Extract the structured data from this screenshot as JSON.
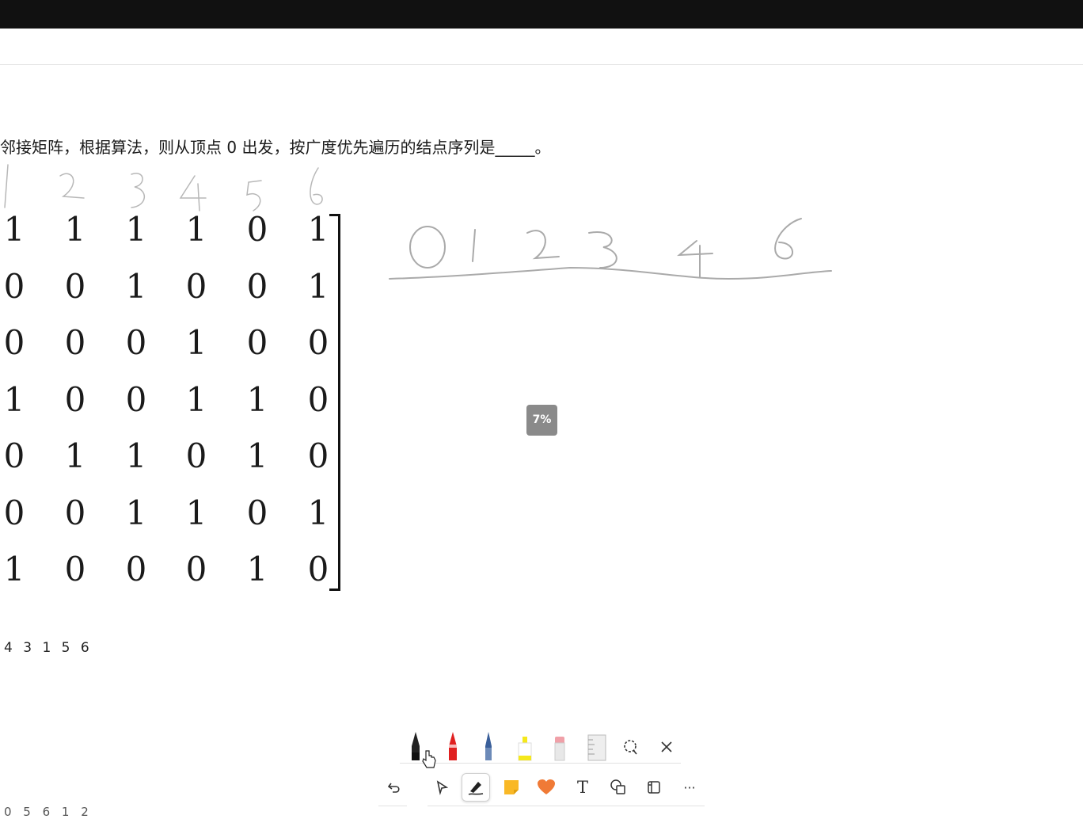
{
  "question": {
    "text": "邻接矩阵，根据算法，则从顶点 0 出发，按广度优先遍历的结点序列是_____。"
  },
  "matrix": {
    "rows": [
      [
        "1",
        "1",
        "1",
        "1",
        "0",
        "1"
      ],
      [
        "0",
        "0",
        "1",
        "0",
        "0",
        "1"
      ],
      [
        "0",
        "0",
        "0",
        "1",
        "0",
        "0"
      ],
      [
        "1",
        "0",
        "0",
        "1",
        "1",
        "0"
      ],
      [
        "0",
        "1",
        "1",
        "0",
        "1",
        "0"
      ],
      [
        "0",
        "0",
        "1",
        "1",
        "0",
        "1"
      ],
      [
        "1",
        "0",
        "0",
        "0",
        "1",
        "0"
      ]
    ]
  },
  "answer_line": "4 3 1 5 6",
  "answer_line_partial": "0 5 6 1 2",
  "zoom_badge": "7%",
  "pen_tray": {
    "pens": [
      {
        "name": "black-pen",
        "color": "#111111"
      },
      {
        "name": "red-pen",
        "color": "#e02020"
      },
      {
        "name": "galaxy-pen",
        "color": "#3a5f9a"
      },
      {
        "name": "yellow-highlighter",
        "color": "#f5e81c"
      },
      {
        "name": "eraser",
        "color": "#f0a0a8"
      },
      {
        "name": "ruler",
        "color": "#dddddd"
      }
    ],
    "lasso_icon": "lasso-icon",
    "close_icon": "close-icon"
  },
  "toolbar": {
    "items": [
      "undo-icon",
      "select-icon",
      "ink-icon",
      "sticky-note-icon",
      "reaction-icon",
      "text-icon",
      "shapes-icon",
      "page-icon",
      "more-icon"
    ],
    "text_glyph": "T",
    "more_glyph": "···"
  },
  "colors": {
    "topbar": "#111111",
    "sticky": "#f9b826",
    "heart": "#f07a36"
  }
}
